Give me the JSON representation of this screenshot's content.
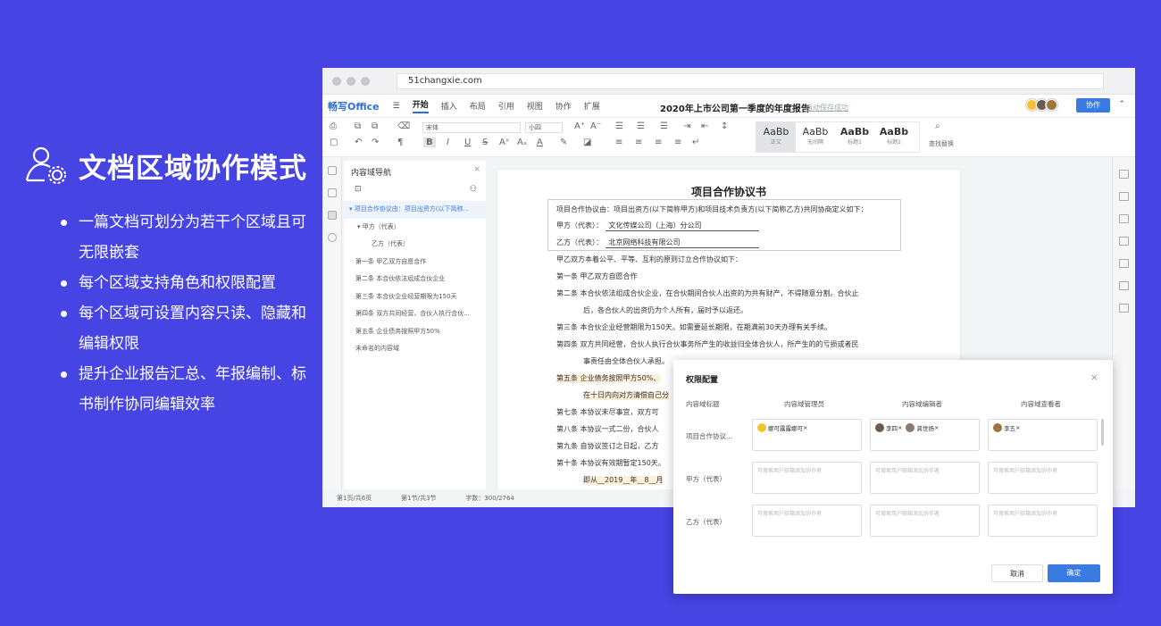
{
  "promo": {
    "title": "文档区域协作模式",
    "bullets": [
      "一篇文档可划分为若干个区域且可无限嵌套",
      "每个区域支持角色和权限配置",
      "每个区域可设置内容只读、隐藏和编辑权限",
      "提升企业报告汇总、年报编制、标书制作协同编辑效率"
    ]
  },
  "browser": {
    "url": "51changxie.com"
  },
  "app": {
    "logo": "畅写Office",
    "menus": [
      "开始",
      "插入",
      "布局",
      "引用",
      "视图",
      "协作",
      "扩展"
    ],
    "doc_title": "2020年上市公司第一季度的年度报告",
    "autosave": "自动保存成功",
    "collab_button": "协作"
  },
  "toolbar": {
    "font": "宋体",
    "size": "小四",
    "styles": [
      {
        "sample": "AaBb",
        "name": "正文"
      },
      {
        "sample": "AaBb",
        "name": "无间隔"
      },
      {
        "sample": "AaBb",
        "name": "标题1"
      },
      {
        "sample": "AaBb",
        "name": "标题2"
      }
    ],
    "find_replace": "查找替换",
    "bold": "B",
    "italic": "I",
    "underline": "U"
  },
  "nav": {
    "title": "内容域导航",
    "items": [
      "项目合作协议由：项目出资方(以下简称...",
      "甲方（代表）",
      "乙方（代表）",
      "第一条 甲乙双方自愿合作",
      "第二条 本合伙依法组成合伙企业",
      "第三条 本合伙企业经营期限为150天",
      "第四条 双方共同经营，合伙人执行合伙...",
      "第五条 企业债务按照甲方50%",
      "未命名的内容域"
    ]
  },
  "doc": {
    "heading": "项目合作协议书",
    "intro": "项目合作协议由：项目出资方(以下简称甲方)和项目技术负责方(以下简称乙方)共同协商定义如下：",
    "party_a_label": "甲方（代表）：",
    "party_a": "文化传媒公司（上海）分公司",
    "party_b_label": "乙方（代表）：",
    "party_b": "北京网络科技有限公司",
    "lines": [
      "甲乙双方本着公平、平等、互利的原则订立合作协议如下：",
      "第一条  甲乙双方自愿合作",
      "第二条  本合伙依法组成合伙企业，在合伙期间合伙人出资的为共有财产，不得随意分割。合伙止",
      "后，各合伙人的出资仍为个人所有，届时予以返还。",
      "第三条  本合伙企业经营期限为150天。如需要延长期限，在期满前30天办理有关手续。",
      "第四条  双方共同经营，合伙人执行合伙事务所产生的收益归全体合伙人，所产生的的亏损或者民",
      "事责任由全体合伙人承担。",
      "第五条  企业债务按照甲方50%、",
      "在十日内向对方清偿自己分",
      "第七条  本协议未尽事宜，双方可",
      "第八条  本协议一式二份，合伙人",
      "第九条  自协议签订之日起，乙方",
      "第十条  本协议有效期暂定150天。",
      "即从__2019__年__8__月"
    ]
  },
  "status": {
    "page": "第1页/共6页",
    "section": "第1节/共3节",
    "words": "字数：300/2764"
  },
  "dialog": {
    "title": "权限配置",
    "cols": [
      "内容域标题",
      "内容域管理员",
      "内容域编辑者",
      "内容域查看者"
    ],
    "rows": [
      {
        "title": "项目合作协议...",
        "admins": [
          "娜可露露娜可"
        ],
        "editors": [
          "李四",
          "龚世扬"
        ],
        "viewers": [
          "李五"
        ]
      },
      {
        "title": "甲方（代表）",
        "admins": [],
        "editors": [],
        "viewers": []
      },
      {
        "title": "乙方（代表）",
        "admins": [],
        "editors": [],
        "viewers": []
      }
    ],
    "placeholder": "可搜索用户邮箱添加协作者",
    "cancel": "取消",
    "ok": "确定"
  }
}
